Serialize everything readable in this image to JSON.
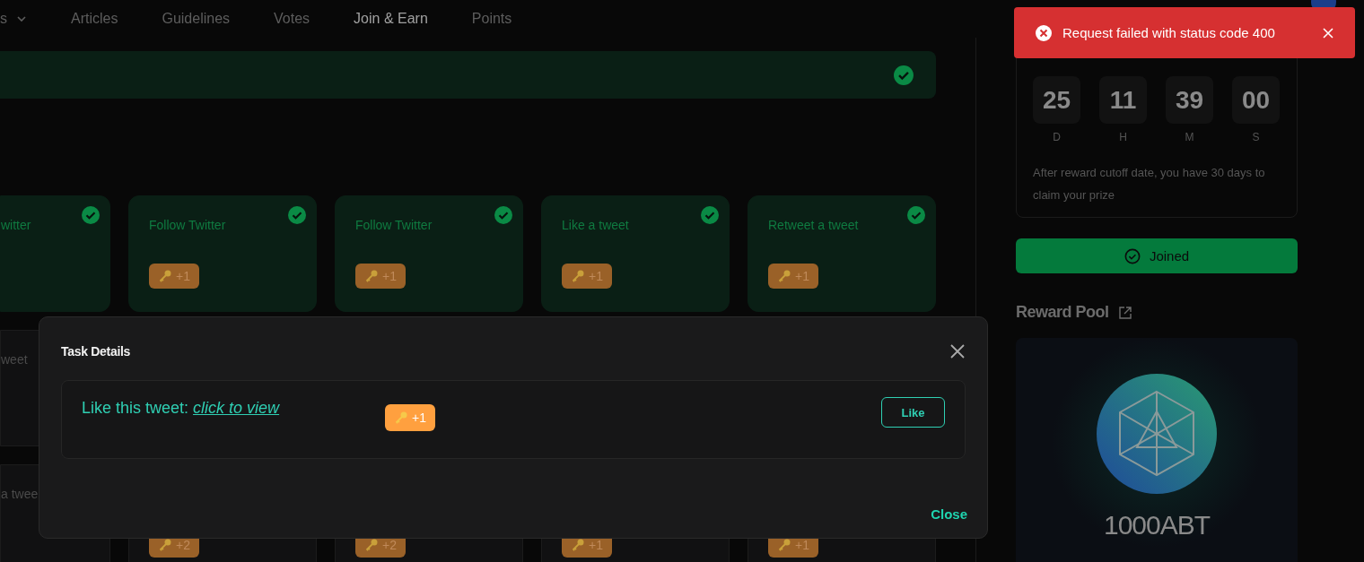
{
  "nav": [
    {
      "label": "s",
      "kind": "dropdown",
      "selected": false
    },
    {
      "label": "Articles",
      "kind": "link",
      "selected": false
    },
    {
      "label": "Guidelines",
      "kind": "link",
      "selected": false
    },
    {
      "label": "Votes",
      "kind": "link",
      "selected": false
    },
    {
      "label": "Join & Earn",
      "kind": "link",
      "selected": true
    },
    {
      "label": "Points",
      "kind": "link",
      "selected": false
    }
  ],
  "banner": {
    "completed": true
  },
  "task_rows": [
    [
      {
        "label": "witter",
        "completed": true
      },
      {
        "label": "Follow Twitter",
        "badge": "+1",
        "completed": true
      },
      {
        "label": "Follow Twitter",
        "badge": "+1",
        "completed": true
      },
      {
        "label": "Like a tweet",
        "badge": "+1",
        "completed": true
      },
      {
        "label": "Retweet a tweet",
        "badge": "+1",
        "completed": true
      }
    ],
    [
      {
        "label": "weet",
        "completed": false
      }
    ],
    [
      {
        "label": "a twee",
        "completed": false
      },
      {
        "badge": "+2",
        "completed": false
      },
      {
        "badge": "+2",
        "completed": false
      },
      {
        "badge": "+1",
        "completed": false
      },
      {
        "badge": "+1",
        "completed": false
      }
    ]
  ],
  "countdown": {
    "units": [
      {
        "value": "25",
        "unit": "D"
      },
      {
        "value": "11",
        "unit": "H"
      },
      {
        "value": "39",
        "unit": "M"
      },
      {
        "value": "00",
        "unit": "S"
      }
    ],
    "note": "After reward cutoff date, you have 30 days to claim your prize"
  },
  "join_button": {
    "label": "Joined",
    "joined": true
  },
  "reward_pool": {
    "title": "Reward Pool",
    "amount": "1000ABT"
  },
  "modal": {
    "title": "Task Details",
    "task_text": "Like this tweet: ",
    "task_link": "click to view",
    "badge": "+1",
    "action": "Like",
    "close": "Close"
  },
  "toast": {
    "message": "Request failed with status code 400",
    "kind": "error"
  }
}
